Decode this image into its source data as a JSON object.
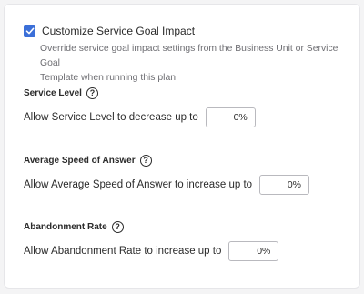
{
  "customize": {
    "checked": true,
    "label": "Customize Service Goal Impact",
    "description_line1": "Override service goal impact settings from the Business Unit or Service Goal",
    "description_line2": "Template when running this plan"
  },
  "sections": [
    {
      "title": "Service Level",
      "help_icon": "question-circle-icon",
      "field_label": "Allow Service Level to decrease up to",
      "value": "0%"
    },
    {
      "title": "Average Speed of Answer",
      "help_icon": "question-circle-icon",
      "field_label": "Allow Average Speed of Answer to increase up to",
      "value": "0%"
    },
    {
      "title": "Abandonment Rate",
      "help_icon": "question-circle-icon",
      "field_label": "Allow Abandonment Rate to increase up to",
      "value": "0%"
    }
  ],
  "colors": {
    "accent": "#3b6fd8",
    "text": "#2b2b2b",
    "muted": "#6e6e73"
  }
}
